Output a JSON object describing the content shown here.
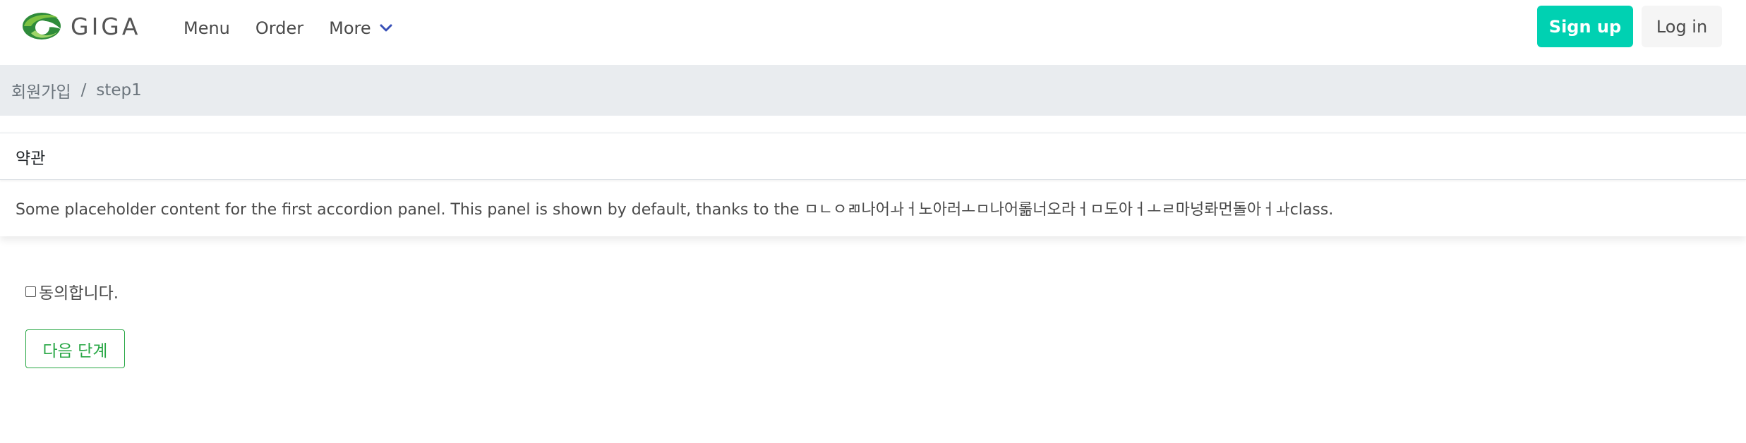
{
  "navbar": {
    "brand_name": "GIGA",
    "items": [
      {
        "label": "Menu"
      },
      {
        "label": "Order"
      },
      {
        "label": "More"
      }
    ],
    "signup_label": "Sign up",
    "login_label": "Log in",
    "colors": {
      "signup_bg": "#00d1b2",
      "login_bg": "#f5f5f5",
      "logo_green": "#7dc242",
      "logo_dark_green": "#2e8b3a",
      "chevron": "#3850b7"
    }
  },
  "breadcrumb": {
    "items": [
      "회원가입",
      "step1"
    ],
    "separator": "/"
  },
  "accordion": {
    "header": "약관",
    "body": "Some placeholder content for the first accordion panel. This panel is shown by default, thanks to the ㅁㄴㅇㄻ나어ㅘㅓ노아러ㅗㅁ나어롦너오라ㅓㅁ도아ㅓㅗㄹ마넝롸먼돌아ㅓㅘclass."
  },
  "agreement": {
    "label": "동의합니다.",
    "checked": false
  },
  "next_button": {
    "label": "다음 단계",
    "color": "#28a745"
  }
}
